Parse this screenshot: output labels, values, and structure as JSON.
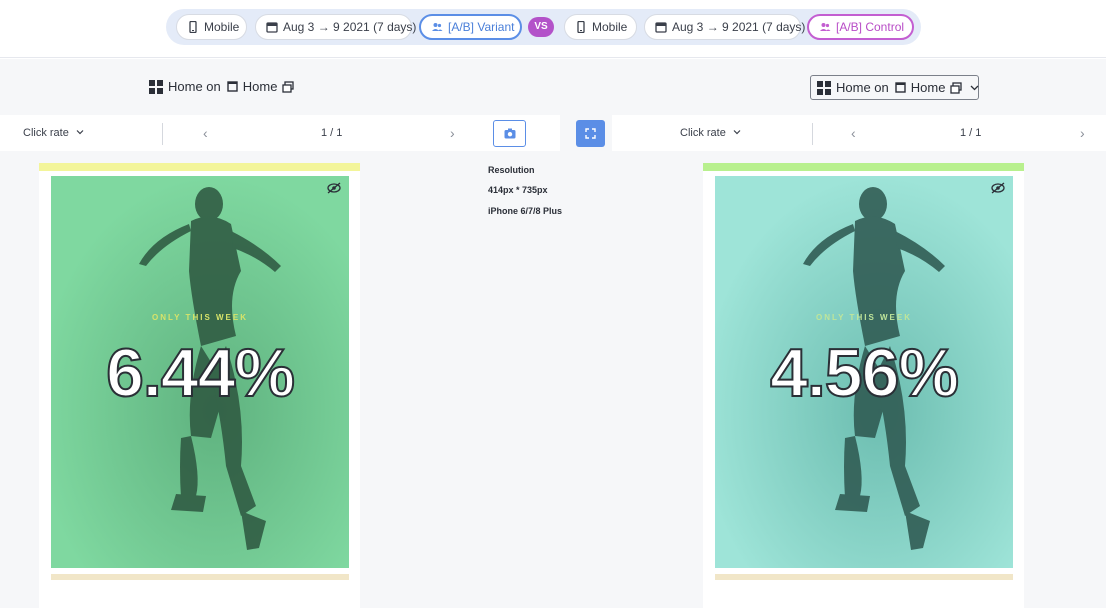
{
  "comparison": {
    "left": {
      "device": "Mobile",
      "date_range": "Aug 3 → 9 2021 (7 days)",
      "segment": "[A/B] Variant"
    },
    "vs_label": "VS",
    "right": {
      "device": "Mobile",
      "date_range": "Aug 3 → 9 2021 (7 days)",
      "segment": "[A/B] Control"
    }
  },
  "left_panel": {
    "screen_prefix": "Home on",
    "screen_name": "Home",
    "metric": "Click rate",
    "page_indicator": "1 / 1",
    "promo_text": "ONLY THIS WEEK",
    "rate": "6.44%"
  },
  "right_panel": {
    "screen_prefix": "Home on",
    "screen_name": "Home",
    "metric": "Click rate",
    "page_indicator": "1 / 1",
    "promo_text": "ONLY THIS WEEK",
    "rate": "4.56%"
  },
  "resolution": {
    "label": "Resolution",
    "size": "414px * 735px",
    "device_model": "iPhone 6/7/8 Plus"
  },
  "colors": {
    "variant_accent": "#5b8ee6",
    "control_accent": "#c35ed1",
    "left_overlay": "#7fd8a0",
    "right_overlay": "#8fe0d2",
    "left_top_bar": "#f3f59a",
    "right_top_bar": "#b8f08e"
  },
  "icons": {
    "device": "mobile-icon",
    "date": "calendar-icon",
    "segment": "users-icon",
    "screen": "grid-layout-icon",
    "capture": "camera-icon",
    "fullscreen": "expand-icon",
    "visibility": "eye-off-icon"
  }
}
